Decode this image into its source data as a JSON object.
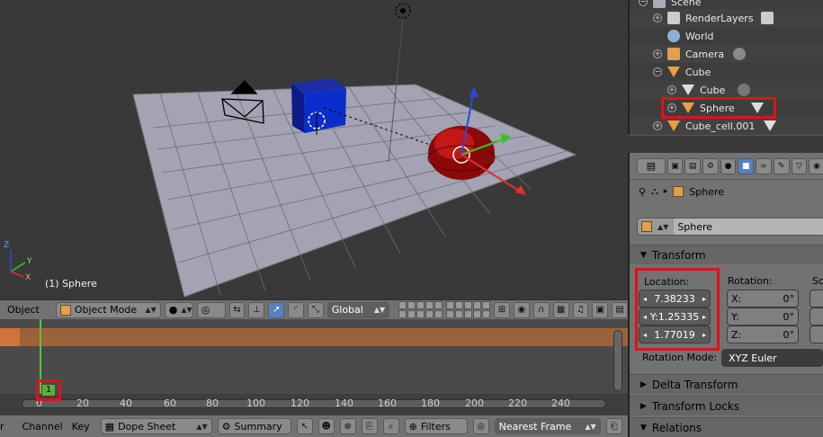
{
  "viewport": {
    "object_label": "(1) Sphere",
    "axis_y": "Y",
    "axis_x": "X",
    "axis_z": "Z"
  },
  "view_header": {
    "menu_object": "Object",
    "mode_label": "Object Mode",
    "orientation_label": "Global"
  },
  "dopesheet": {
    "current_frame": "1",
    "ticks": [
      "0",
      "20",
      "40",
      "60",
      "80",
      "100",
      "120",
      "140",
      "160",
      "180",
      "200",
      "220",
      "240"
    ]
  },
  "dopesheet_header": {
    "menu_view": "r",
    "menu_channel": "Channel",
    "menu_key": "Key",
    "mode_label": "Dope Sheet",
    "summary_label": "Summary",
    "filters_label": "Filters",
    "snap_label": "Nearest Frame"
  },
  "outliner": {
    "items": [
      {
        "label": "Scene"
      },
      {
        "label": "RenderLayers"
      },
      {
        "label": "World"
      },
      {
        "label": "Camera"
      },
      {
        "label": "Cube"
      },
      {
        "label": "Cube"
      },
      {
        "label": "Sphere"
      },
      {
        "label": "Cube_cell.001"
      }
    ]
  },
  "properties": {
    "breadcrumb_object": "Sphere",
    "object_name": "Sphere",
    "transform_label": "Transform",
    "location_label": "Location:",
    "rotation_label": "Rotation:",
    "scale_label": "Sca",
    "location": {
      "x": "7.38233",
      "y": "Y:1.25335",
      "z": "1.77019"
    },
    "rotation": {
      "x_label": "X:",
      "x": "0°",
      "y_label": "Y:",
      "y": "0°",
      "z_label": "Z:",
      "z": "0°"
    },
    "rotation_mode_label": "Rotation Mode:",
    "rotation_mode_value": "XYZ Euler",
    "delta_transform_label": "Delta Transform",
    "transform_locks_label": "Transform Locks",
    "relations_label": "Relations"
  },
  "colors": {
    "selection_highlight": "#e0101a",
    "frame_green": "#60c040",
    "active_blue": "#5680c2"
  }
}
